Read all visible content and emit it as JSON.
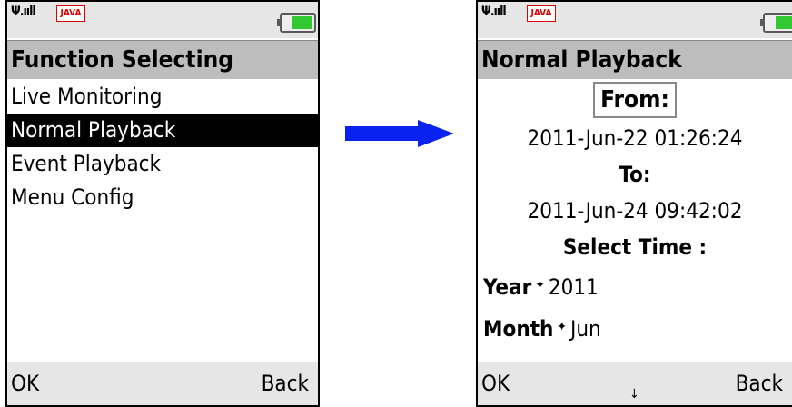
{
  "left_screen": {
    "status": {
      "signal": "Ψ.ııll",
      "java_badge": "JAVA"
    },
    "title": "Function Selecting",
    "menu_items": [
      "Live Monitoring",
      "Normal Playback",
      "Event Playback",
      "Menu Config"
    ],
    "selected_index": 1,
    "softkeys": {
      "left": "OK",
      "right": "Back"
    }
  },
  "right_screen": {
    "status": {
      "signal": "Ψ.ııll",
      "java_badge": "JAVA"
    },
    "title": "Normal Playback",
    "from_label": "From:",
    "from_date": "2011-Jun-22 01:26:24",
    "to_label": "To:",
    "to_date": "2011-Jun-24 09:42:02",
    "select_time_label": "Select Time :",
    "fields": [
      {
        "name": "Year",
        "value": "2011"
      },
      {
        "name": "Month",
        "value": "Jun"
      }
    ],
    "softkeys": {
      "left": "OK",
      "right": "Back"
    },
    "scroll_indicator": "↓"
  },
  "colors": {
    "arrow": "#0a22f0",
    "selection": "#000000",
    "titlebar": "#bdbdbd",
    "battery": "#31c831"
  }
}
